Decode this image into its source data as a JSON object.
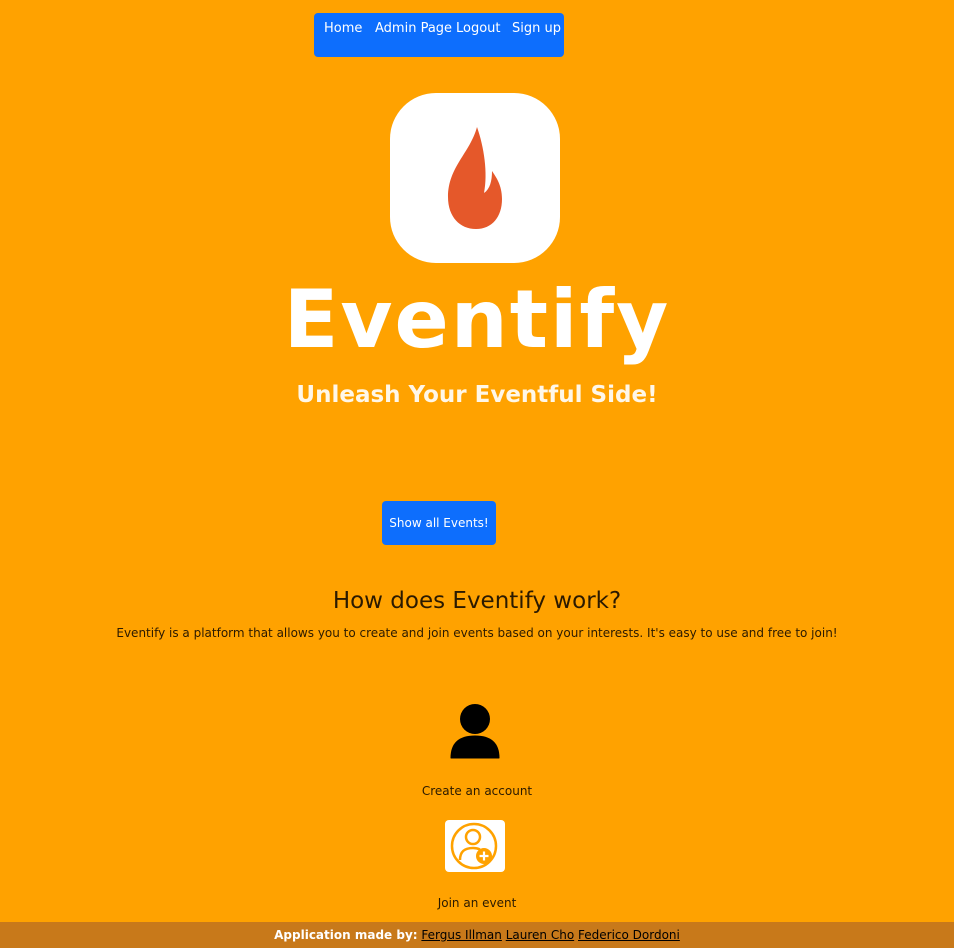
{
  "nav": {
    "items": [
      {
        "label": "Home"
      },
      {
        "label": "Admin Page"
      },
      {
        "label": "Logout"
      },
      {
        "label": "Sign up"
      }
    ]
  },
  "hero": {
    "brand": "Eventify",
    "tagline": "Unleash Your Eventful Side!",
    "logo_icon": "flame-icon"
  },
  "actions": {
    "show_events": "Show all Events!"
  },
  "how": {
    "title": "How does Eventify work?",
    "description": "Eventify is a platform that allows you to create and join events based on your interests. It's easy to use and free to join!",
    "steps": [
      {
        "label": "Create an account",
        "icon": "user-icon"
      },
      {
        "label": "Join an event",
        "icon": "user-add-icon"
      }
    ]
  },
  "footer": {
    "made_by": "Application made by:",
    "authors": [
      "Fergus Illman",
      "Lauren Cho",
      "Federico Dordoni"
    ]
  },
  "colors": {
    "background": "#ffa200",
    "primary": "#0d6efd",
    "flame": "#e5582a",
    "footer": "#c8791a"
  }
}
